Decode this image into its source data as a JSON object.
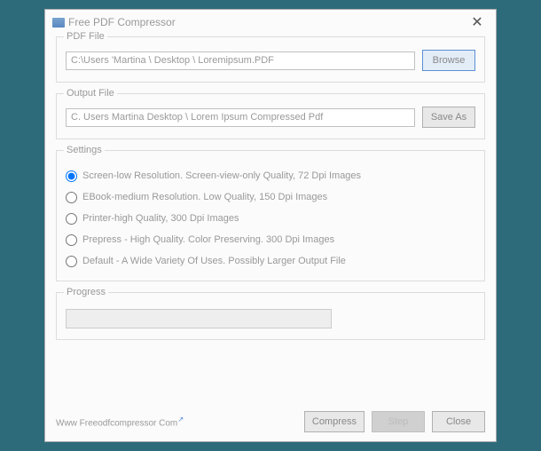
{
  "titlebar": {
    "title": "Free PDF Compressor",
    "close": "✕"
  },
  "pdf_file": {
    "label": "PDF File",
    "value": "C:\\Users 'Martina \\ Desktop \\ Loremipsum.PDF",
    "browse": "Browse"
  },
  "output_file": {
    "label": "Output File",
    "value": "C. Users Martina Desktop \\ Lorem Ipsum Compressed Pdf",
    "save_as": "Save As"
  },
  "settings": {
    "label": "Settings",
    "options": [
      "Screen-low Resolution. Screen-view-only Quality, 72 Dpi Images",
      "EBook-medium Resolution. Low Quality, 150 Dpi Images",
      "Printer-high Quality, 300 Dpi Images",
      "Prepress - High Quality. Color Preserving. 300 Dpi Images",
      "Default - A Wide Variety Of Uses. Possibly Larger Output File"
    ]
  },
  "progress": {
    "label": "Progress"
  },
  "footer": {
    "link": "Www Freeodfcompressor Com",
    "compress": "Compress",
    "step": "Step",
    "close": "Close"
  }
}
